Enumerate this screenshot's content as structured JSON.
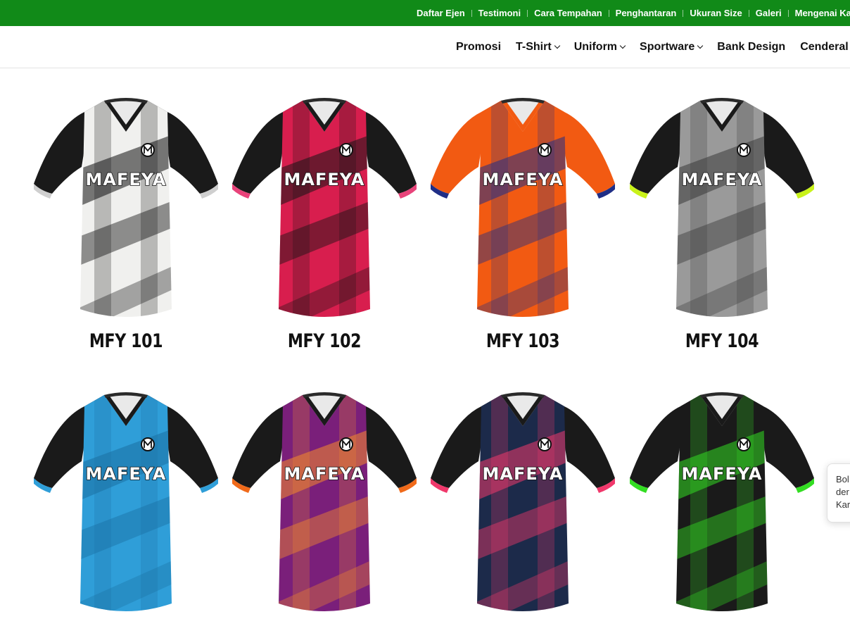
{
  "topbar": {
    "items": [
      "Daftar Ejen",
      "Testimoni",
      "Cara Tempahan",
      "Penghantaran",
      "Ukuran Size",
      "Galeri",
      "Mengenai Ka"
    ]
  },
  "nav": {
    "items": [
      {
        "label": "Promosi",
        "dropdown": false
      },
      {
        "label": "T-Shirt",
        "dropdown": true
      },
      {
        "label": "Uniform",
        "dropdown": true
      },
      {
        "label": "Sportware",
        "dropdown": true
      },
      {
        "label": "Bank Design",
        "dropdown": false
      },
      {
        "label": "Cenderal",
        "dropdown": false
      }
    ]
  },
  "products": [
    {
      "code": "MFY 101",
      "brand": "MAFEYA",
      "body": "#f0f0ee",
      "sleeve": "#1a1a1a",
      "accent": "#111111",
      "trim": "#cfcfcf"
    },
    {
      "code": "MFY 102",
      "brand": "MAFEYA",
      "body": "#d81e4e",
      "sleeve": "#1a1a1a",
      "accent": "#151515",
      "trim": "#e8437a"
    },
    {
      "code": "MFY 103",
      "brand": "MAFEYA",
      "body": "#f25a12",
      "sleeve": "#f25a12",
      "accent": "#1f2e86",
      "trim": "#1f2e86"
    },
    {
      "code": "MFY 104",
      "brand": "MAFEYA",
      "body": "#9a9a9a",
      "sleeve": "#1a1a1a",
      "accent": "#3a3a3a",
      "trim": "#c9f21a"
    },
    {
      "code": "",
      "brand": "MAFEYA",
      "body": "#2f9ed8",
      "sleeve": "#1a1a1a",
      "accent": "#1a6fa3",
      "trim": "#2f9ed8"
    },
    {
      "code": "",
      "brand": "MAFEYA",
      "body": "#7a1f7a",
      "sleeve": "#1a1a1a",
      "accent": "#f58a2a",
      "trim": "#f06a1a"
    },
    {
      "code": "",
      "brand": "MAFEYA",
      "body": "#1c2a4a",
      "sleeve": "#1a1a1a",
      "accent": "#f0386b",
      "trim": "#f0386b"
    },
    {
      "code": "",
      "brand": "MAFEYA",
      "body": "#1a1a1a",
      "sleeve": "#1a1a1a",
      "accent": "#33dd22",
      "trim": "#33dd22"
    }
  ],
  "chat": {
    "lines": [
      "Bol",
      "der",
      "Kar"
    ]
  }
}
